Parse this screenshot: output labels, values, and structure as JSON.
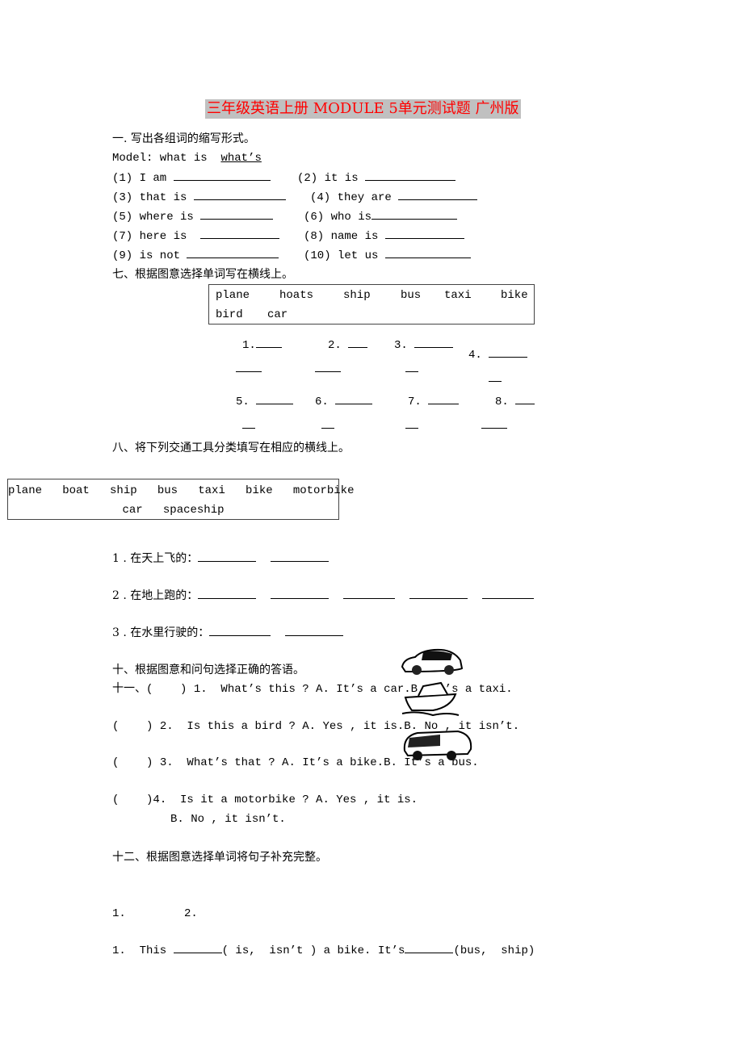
{
  "title": "三年级英语上册 MODULE 5单元测试题 广州版",
  "section1": {
    "heading": "一. 写出各组词的缩写形式。",
    "model_label": "Model: what is",
    "model_answer": "what’s",
    "items": [
      {
        "left": "(1) I am",
        "right": "(2) it is"
      },
      {
        "left": "(3) that is",
        "right": "(4) they are"
      },
      {
        "left": "(5) where is",
        "right": "(6) who is"
      },
      {
        "left": "(7) here is",
        "right": "(8) name is"
      },
      {
        "left": "(9) is not",
        "right": "(10) let us"
      }
    ]
  },
  "section7": {
    "heading": "七、根据图意选择单词写在横线上。",
    "words_row1": [
      "plane",
      "hoats",
      "ship",
      "bus",
      "taxi",
      "bike"
    ],
    "words_row2": [
      "bird",
      "car"
    ],
    "numbers": [
      "1.",
      "2.",
      "3.",
      "4.",
      "5.",
      "6.",
      "7.",
      "8."
    ]
  },
  "section8": {
    "heading": "八、将下列交通工具分类填写在相应的横线上。",
    "words_row1": "plane   boat   ship   bus   taxi   bike   motorbike",
    "words_row2": "car   spaceship",
    "categories": [
      {
        "label": "1 . 在天上飞的：",
        "blanks": 2
      },
      {
        "label": "2 . 在地上跑的：",
        "blanks": 5
      },
      {
        "label": "3 . 在水里行驶的：",
        "blanks": 2
      }
    ]
  },
  "section10": {
    "heading": "十、根据图意和问句选择正确的答语。",
    "questions": [
      {
        "prefix": "十一、(    )",
        "text": "1.  What’s this ? A. It’s a car.B. It’s a taxi."
      },
      {
        "prefix": "(    )",
        "text": "2.  Is this a bird ? A. Yes , it is.B. No , it isn’t."
      },
      {
        "prefix": "(    )",
        "text": "3.  What’s that ? A. It’s a bike.B. It’s a bus."
      },
      {
        "prefix": "(    )",
        "text": "4.  Is it a motorbike ? A. Yes , it is."
      }
    ],
    "q4_option_b": "B. No , it isn’t.",
    "pictures": [
      "car-picture",
      "boat-picture",
      "bus-picture"
    ]
  },
  "section12": {
    "heading": "十二、根据图意选择单词将句子补充完整。",
    "picture_numbers": [
      "1.",
      "2."
    ],
    "sentence1_a": "1.  This",
    "sentence1_b": "( is,  isn’t ) a bike. It’s",
    "sentence1_c": "(bus,  ship)"
  }
}
